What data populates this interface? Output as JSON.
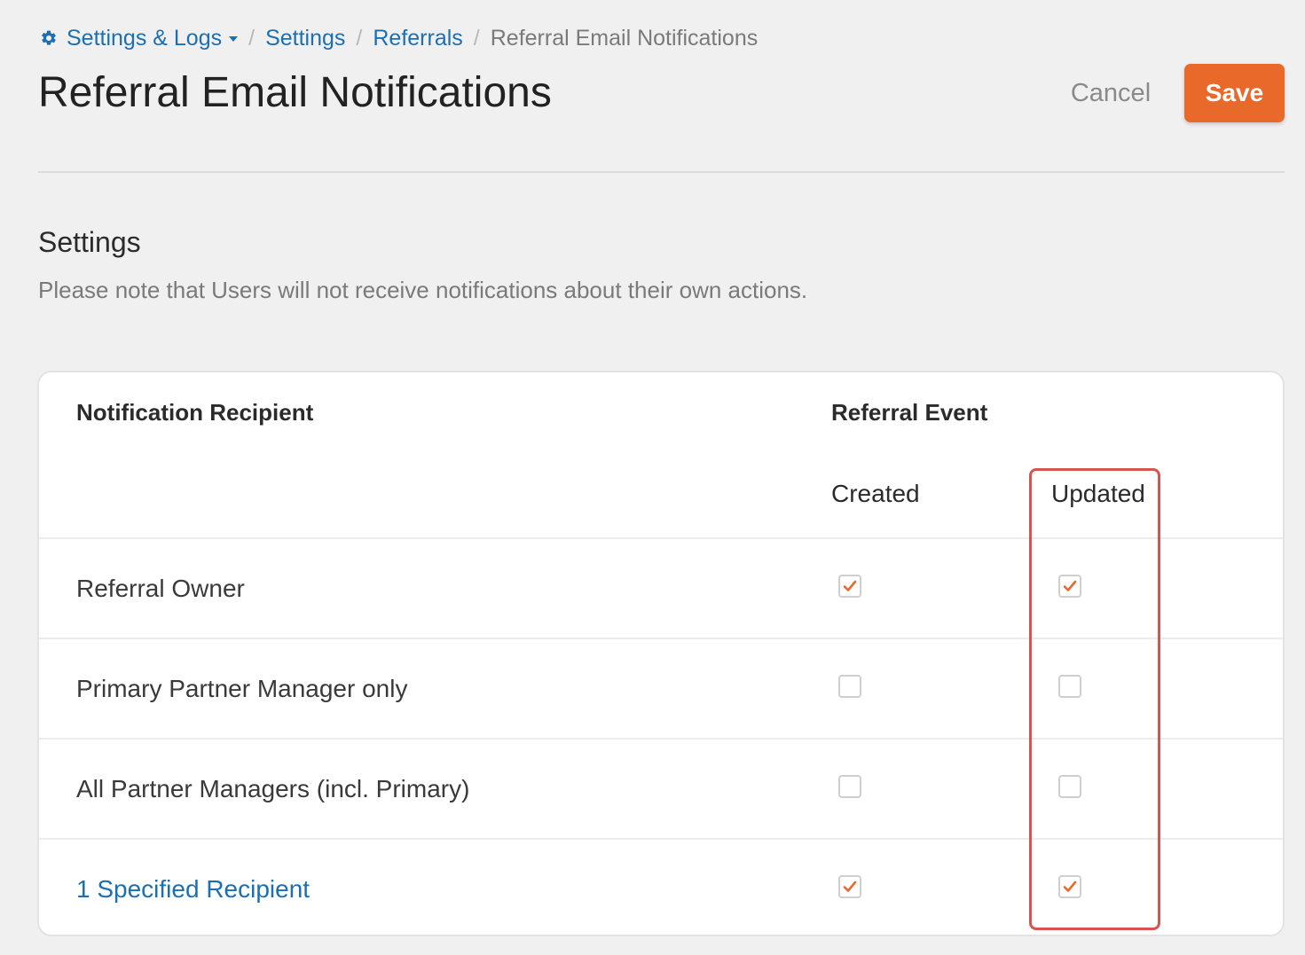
{
  "breadcrumb": {
    "root": "Settings & Logs",
    "level2": "Settings",
    "level3": "Referrals",
    "current": "Referral Email Notifications",
    "separator": "/"
  },
  "header": {
    "title": "Referral Email Notifications",
    "cancel_label": "Cancel",
    "save_label": "Save"
  },
  "section": {
    "title": "Settings",
    "note": "Please note that Users will not receive notifications about their own actions."
  },
  "table": {
    "recipient_header": "Notification Recipient",
    "event_header": "Referral Event",
    "columns": [
      "Created",
      "Updated"
    ],
    "rows": [
      {
        "label": "Referral Owner",
        "created": true,
        "updated": true,
        "link": false
      },
      {
        "label": "Primary Partner Manager only",
        "created": false,
        "updated": false,
        "link": false
      },
      {
        "label": "All Partner Managers (incl. Primary)",
        "created": false,
        "updated": false,
        "link": false
      },
      {
        "label": "1 Specified Recipient",
        "created": true,
        "updated": true,
        "link": true
      }
    ]
  },
  "colors": {
    "accent": "#e8692a",
    "link": "#1b6fb3",
    "highlight": "#d9534f"
  },
  "icons": {
    "breadcrumb_root": "gear-icon",
    "dropdown": "caret-down-icon",
    "checked": "checkmark-icon"
  }
}
